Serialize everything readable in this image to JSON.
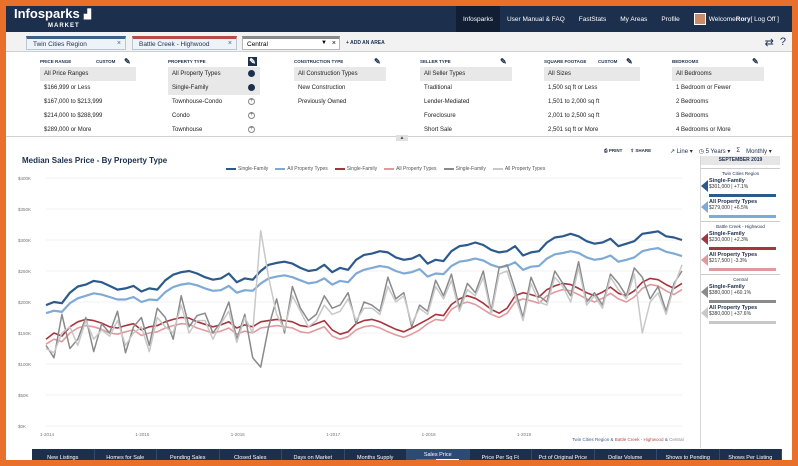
{
  "logo": {
    "main": "Infosparks",
    "sub": "MARKET"
  },
  "nav": [
    "Infosparks",
    "User Manual & FAQ",
    "FastStats",
    "My Areas",
    "Profile"
  ],
  "user": {
    "welcome_prefix": "Welcome ",
    "name": "Rory",
    "logoff": " [ Log Off ]"
  },
  "areas": {
    "tab1": "Twin Cities Region",
    "tab2": "Battle Creek - Highwood",
    "select_value": "Central",
    "add_label": "+ ADD AN AREA",
    "close_symbol": "×",
    "caret": "▼"
  },
  "filters": {
    "custom_label": "CUSTOM",
    "price_range": {
      "title": "PRICE RANGE",
      "items": [
        "All Price Ranges",
        "$166,999 or Less",
        "$167,000 to $213,999",
        "$214,000 to $288,999",
        "$289,000 or More"
      ]
    },
    "property_type": {
      "title": "PROPERTY TYPE",
      "items": [
        "All Property Types",
        "Single-Family",
        "Townhouse-Condo",
        "Condo",
        "Townhouse"
      ]
    },
    "construction_type": {
      "title": "CONSTRUCTION TYPE",
      "items": [
        "All Construction Types",
        "New Construction",
        "Previously Owned"
      ]
    },
    "seller_type": {
      "title": "SELLER TYPE",
      "items": [
        "All Seller Types",
        "Traditional",
        "Lender-Mediated",
        "Foreclosure",
        "Short Sale"
      ]
    },
    "square_footage": {
      "title": "SQUARE FOOTAGE",
      "items": [
        "All Sizes",
        "1,500 sq ft or Less",
        "1,501 to 2,000 sq ft",
        "2,001 to 2,500 sq ft",
        "2,501 sq ft or More"
      ]
    },
    "bedrooms": {
      "title": "BEDROOMS",
      "items": [
        "All Bedrooms",
        "1 Bedroom or Fewer",
        "2 Bedrooms",
        "3 Bedrooms",
        "4 Bedrooms or More"
      ]
    }
  },
  "chart_header": {
    "title": "Median Sales Price - By Property Type",
    "print": "PRINT",
    "share": "SHARE",
    "view_type": "Line",
    "range": "5 Years",
    "sigma": "Σ",
    "interval": "Monthly"
  },
  "colors": {
    "navy": "#1c2f4d",
    "blue_dark": "#2c5a8c",
    "blue_light": "#7faad6",
    "red_dark": "#a8353d",
    "red_light": "#e09a9d",
    "gray_dark": "#8a8a8a",
    "gray_light": "#c8c8c8"
  },
  "caption": {
    "a": "Twin Cities Region",
    "sep1": " & ",
    "b": "Battle Creek - Highwood",
    "sep2": " & ",
    "c": "Central"
  },
  "chart_data": {
    "type": "line",
    "title": "Median Sales Price - By Property Type",
    "ylim": [
      0,
      400000
    ],
    "y_ticks": [
      "$0K",
      "$50K",
      "$100K",
      "$150K",
      "$200K",
      "$250K",
      "$300K",
      "$350K",
      "$400K"
    ],
    "x_ticks": [
      "1-2014",
      "1-2015",
      "1-2016",
      "1-2017",
      "1-2018",
      "1-2019"
    ],
    "legend": [
      {
        "name": "Single-Family",
        "color": "#2c5a8c"
      },
      {
        "name": "All Property Types",
        "color": "#7faad6"
      },
      {
        "name": "Single-Family",
        "color": "#a8353d"
      },
      {
        "name": "All Property Types",
        "color": "#e09a9d"
      },
      {
        "name": "Single-Family",
        "color": "#8a8a8a"
      },
      {
        "name": "All Property Types",
        "color": "#c8c8c8"
      }
    ],
    "series": [
      {
        "name": "Single-Family",
        "area": "Twin Cities Region",
        "color": "#2c5a8c",
        "width": 2.2,
        "values": [
          195,
          200,
          198,
          215,
          225,
          228,
          234,
          232,
          226,
          220,
          222,
          226,
          217,
          222,
          220,
          235,
          244,
          248,
          250,
          246,
          240,
          236,
          238,
          246,
          232,
          238,
          236,
          250,
          260,
          263,
          265,
          262,
          255,
          250,
          252,
          260,
          248,
          255,
          252,
          268,
          276,
          278,
          282,
          280,
          272,
          268,
          270,
          276,
          262,
          268,
          266,
          282,
          290,
          292,
          296,
          292,
          284,
          280,
          282,
          290,
          275,
          280,
          282,
          296,
          304,
          306,
          310,
          306,
          298,
          294,
          296,
          302,
          290,
          294,
          298,
          310,
          312,
          314,
          306,
          304,
          300
        ]
      },
      {
        "name": "All Property Types",
        "area": "Twin Cities Region",
        "color": "#7faad6",
        "width": 2.2,
        "values": [
          182,
          186,
          184,
          198,
          206,
          210,
          214,
          212,
          208,
          204,
          204,
          208,
          200,
          204,
          203,
          216,
          224,
          228,
          230,
          227,
          222,
          218,
          219,
          226,
          215,
          219,
          218,
          230,
          238,
          241,
          243,
          240,
          235,
          230,
          232,
          238,
          228,
          234,
          232,
          246,
          252,
          255,
          258,
          256,
          250,
          246,
          248,
          253,
          241,
          246,
          245,
          258,
          265,
          267,
          270,
          267,
          260,
          256,
          258,
          264,
          252,
          257,
          258,
          270,
          277,
          279,
          282,
          279,
          272,
          268,
          270,
          275,
          265,
          268,
          272,
          282,
          285,
          287,
          281,
          278,
          274
        ]
      },
      {
        "name": "Single-Family",
        "area": "Battle Creek - Highwood",
        "color": "#a8353d",
        "width": 1.6,
        "values": [
          140,
          150,
          145,
          160,
          168,
          172,
          170,
          166,
          160,
          158,
          162,
          165,
          155,
          160,
          162,
          168,
          172,
          175,
          174,
          168,
          164,
          160,
          163,
          168,
          158,
          163,
          160,
          168,
          170,
          172,
          170,
          168,
          162,
          160,
          165,
          170,
          155,
          148,
          152,
          165,
          170,
          172,
          168,
          162,
          156,
          152,
          158,
          165,
          172,
          180,
          178,
          196,
          205,
          210,
          206,
          198,
          188,
          182,
          190,
          210,
          215,
          212,
          208,
          220,
          226,
          230,
          228,
          222,
          215,
          210,
          216,
          224,
          214,
          210,
          218,
          232,
          238,
          236,
          228,
          222,
          230
        ]
      },
      {
        "name": "All Property Types",
        "area": "Battle Creek - Highwood",
        "color": "#e09a9d",
        "width": 1.6,
        "values": [
          132,
          140,
          136,
          150,
          158,
          162,
          160,
          156,
          150,
          148,
          152,
          155,
          146,
          150,
          152,
          158,
          162,
          165,
          164,
          158,
          154,
          150,
          153,
          158,
          148,
          153,
          150,
          158,
          160,
          162,
          160,
          158,
          152,
          150,
          155,
          160,
          145,
          140,
          144,
          155,
          160,
          162,
          158,
          152,
          147,
          143,
          148,
          155,
          165,
          172,
          170,
          188,
          196,
          200,
          196,
          188,
          180,
          175,
          182,
          200,
          205,
          202,
          198,
          210,
          216,
          220,
          218,
          212,
          205,
          200,
          206,
          214,
          205,
          200,
          208,
          222,
          228,
          226,
          218,
          212,
          220
        ]
      },
      {
        "name": "Single-Family",
        "area": "Central",
        "color": "#8a8a8a",
        "width": 1.5,
        "values": [
          130,
          110,
          180,
          125,
          140,
          175,
          120,
          165,
          150,
          185,
          118,
          160,
          175,
          130,
          190,
          175,
          140,
          210,
          160,
          178,
          182,
          150,
          168,
          200,
          140,
          180,
          110,
          95,
          160,
          205,
          150,
          225,
          190,
          170,
          180,
          210,
          190,
          195,
          215,
          165,
          200,
          195,
          185,
          240,
          205,
          215,
          160,
          195,
          185,
          235,
          210,
          245,
          190,
          230,
          215,
          250,
          185,
          255,
          260,
          220,
          175,
          240,
          210,
          200,
          250,
          230,
          210,
          265,
          200,
          215,
          195,
          245,
          230,
          210,
          255,
          240,
          205,
          225,
          185,
          230,
          250
        ]
      },
      {
        "name": "All Property Types",
        "area": "Central",
        "color": "#c8c8c8",
        "width": 1.5,
        "values": [
          125,
          118,
          150,
          160,
          130,
          170,
          140,
          155,
          145,
          170,
          130,
          150,
          160,
          120,
          175,
          160,
          150,
          195,
          150,
          170,
          170,
          140,
          165,
          185,
          135,
          175,
          150,
          315,
          240,
          180,
          155,
          210,
          185,
          160,
          170,
          195,
          180,
          185,
          205,
          170,
          190,
          190,
          180,
          225,
          200,
          210,
          165,
          190,
          180,
          225,
          205,
          235,
          185,
          220,
          210,
          240,
          180,
          245,
          250,
          210,
          170,
          230,
          200,
          195,
          240,
          225,
          200,
          255,
          195,
          210,
          190,
          240,
          220,
          205,
          245,
          150,
          200,
          215,
          180,
          225,
          260
        ]
      }
    ]
  },
  "side_panel": {
    "header": "SEPTEMBER 2019",
    "groups": [
      {
        "area": "Twin Cities Region",
        "items": [
          {
            "type": "Single-Family",
            "value": "$301,000 | +7.1%",
            "color": "#2c5a8c"
          },
          {
            "type": "All Property Types",
            "value": "$279,000 | +6.5%",
            "color": "#7faad6"
          }
        ]
      },
      {
        "area": "Battle Creek - Highwood",
        "items": [
          {
            "type": "Single-Family",
            "value": "$230,000 | +2.3%",
            "color": "#a8353d"
          },
          {
            "type": "All Property Types",
            "value": "$217,500 | -3.3%",
            "color": "#e09a9d"
          }
        ]
      },
      {
        "area": "Central",
        "items": [
          {
            "type": "Single-Family",
            "value": "$380,000 | +60.1%",
            "color": "#8a8a8a"
          },
          {
            "type": "All Property Types",
            "value": "$380,000 | +37.6%",
            "color": "#c8c8c8"
          }
        ]
      }
    ]
  },
  "bottom_tabs": [
    "New Listings",
    "Homes for Sale",
    "Pending Sales",
    "Closed Sales",
    "Days on Market",
    "Months Supply",
    "Sales Price",
    "Price Per Sq Ft",
    "Pct of Original Price",
    "Dollar Volume",
    "Shows to Pending",
    "Shows Per Listing"
  ],
  "sales_price_toggle": {
    "median": "MEDIAN",
    "average": "AVERAGE"
  }
}
